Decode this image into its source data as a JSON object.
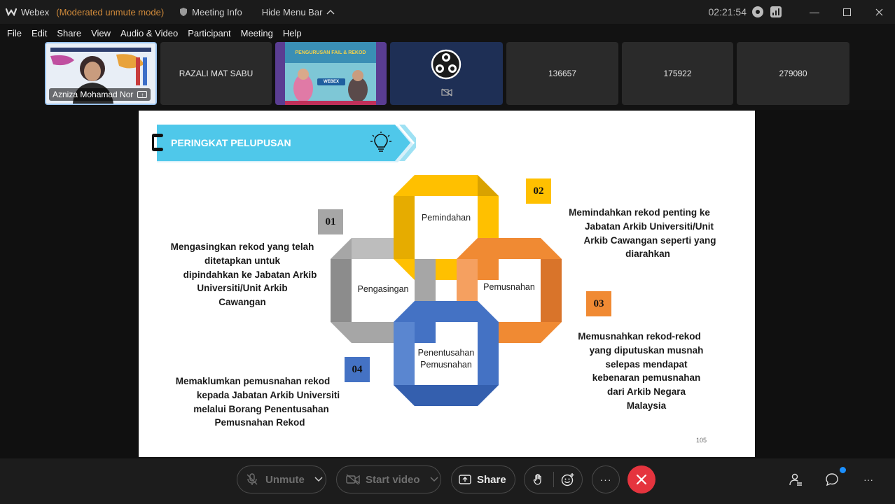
{
  "titlebar": {
    "app_name": "Webex",
    "mode": "(Moderated unmute mode)",
    "meeting_info": "Meeting Info",
    "hide_menu_bar": "Hide Menu Bar",
    "clock": "02:21:54"
  },
  "menu": [
    "File",
    "Edit",
    "Share",
    "View",
    "Audio & Video",
    "Participant",
    "Meeting",
    "Help"
  ],
  "participants": [
    {
      "name": "Azniza Mohamad Nor"
    },
    {
      "name": "RAZALI MAT SABU"
    },
    {
      "name": ""
    },
    {
      "name": ""
    },
    {
      "name": "136657"
    },
    {
      "name": "175922"
    },
    {
      "name": "279080"
    }
  ],
  "poster": {
    "title": "PENGURUSAN FAIL & REKOD",
    "brand": "WEBEX"
  },
  "slide": {
    "heading": "PERINGKAT PELUPUSAN",
    "page_number": "105",
    "rings": {
      "pemindahan": "Pemindahan",
      "pengasingan": "Pengasingan",
      "pemusnahan": "Pemusnahan",
      "penentusahan_line1": "Penentusahan",
      "penentusahan_line2": "Pemusnahan"
    },
    "steps": [
      {
        "num": "01",
        "color": "#a6a6a6",
        "lines": [
          "Mengasingkan rekod yang telah",
          "ditetapkan untuk",
          "dipindahkan ke Jabatan Arkib",
          "Universiti/Unit Arkib",
          "Cawangan"
        ]
      },
      {
        "num": "02",
        "color": "#ffc000",
        "lines": [
          "Memindahkan rekod penting ke",
          "Jabatan Arkib Universiti/Unit",
          "Arkib Cawangan seperti yang",
          "diarahkan"
        ]
      },
      {
        "num": "03",
        "color": "#f08a33",
        "lines": [
          "Memusnahkan rekod-rekod",
          "yang diputuskan musnah",
          "selepas mendapat",
          "kebenaran pemusnahan",
          "dari Arkib Negara",
          "Malaysia"
        ]
      },
      {
        "num": "04",
        "color": "#4472c4",
        "lines": [
          "Memaklumkan pemusnahan rekod",
          "kepada Jabatan Arkib Universiti",
          "melalui Borang Penentusahan",
          "Pemusnahan Rekod"
        ]
      }
    ]
  },
  "controls": {
    "unmute": "Unmute",
    "start_video": "Start video",
    "share": "Share",
    "more": "···",
    "overflow": "···"
  },
  "colors": {
    "yellow": "#ffc000",
    "orange": "#f08a33",
    "grey": "#a6a6a6",
    "blue": "#4472c4",
    "banner": "#4fc8ea",
    "end_call": "#e5343e"
  }
}
